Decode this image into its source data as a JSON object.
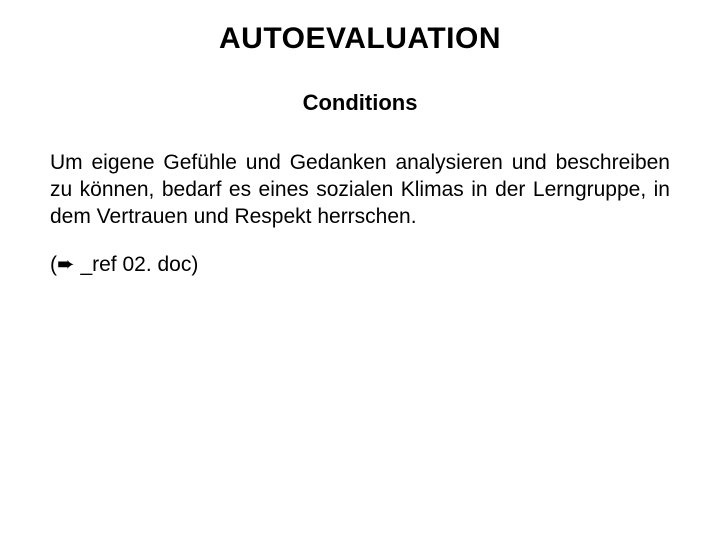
{
  "title": "AUTOEVALUATION",
  "subtitle": "Conditions",
  "body_text": "Um eigene Gefühle und Gedanken analysieren und beschreiben zu können, bedarf es eines sozialen Klimas in der Lerngruppe, in dem Vertrauen und Respekt herrschen.",
  "ref_open": "(",
  "arrow_glyph": "➨",
  "ref_text": " _ref 02. doc)"
}
